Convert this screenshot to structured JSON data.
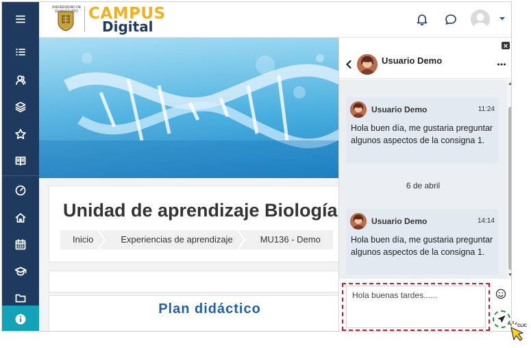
{
  "header": {
    "university_name": "UNIVERSIDAD DE GUANAJUATO",
    "logo_line1": "CAMPUS",
    "logo_line2": "Digital"
  },
  "sidebar": {
    "items": [
      {
        "icon": "menu-icon"
      },
      {
        "icon": "list-icon"
      },
      {
        "icon": "participants-icon"
      },
      {
        "icon": "layers-icon"
      },
      {
        "icon": "star-icon"
      },
      {
        "icon": "book-icon"
      },
      {
        "icon": "gauge-icon"
      },
      {
        "icon": "home-icon"
      },
      {
        "icon": "calendar-icon"
      },
      {
        "icon": "graduation-cap-icon"
      },
      {
        "icon": "folder-icon"
      },
      {
        "icon": "info-icon"
      }
    ]
  },
  "course": {
    "title": "Unidad de aprendizaje Biología",
    "breadcrumb": [
      "Inicio",
      "Experiencias de aprendizaje",
      "MU136 - Demo"
    ],
    "section_title": "Plan didáctico"
  },
  "chat": {
    "contact_name": "Usuario Demo",
    "messages": [
      {
        "sender": "Usuario Demo",
        "time": "11:24",
        "text": "Hola buen día, me gustaria preguntar algunos aspectos de la consigna 1."
      },
      {
        "sender": "Usuario Demo",
        "time": "14:14",
        "text": "Hola buen día, me gustaria preguntar algunos aspectos de la consigna 1."
      }
    ],
    "date_separator": "6 de abril",
    "compose_value": "Hola buenas tardes......",
    "cursor_label": "CLIC"
  },
  "colors": {
    "sidebar": "#1f3a5f",
    "accent": "#12a3b8",
    "logo_gold": "#f2b01e",
    "highlight_red": "#d4132b",
    "highlight_green": "#2d8a3c"
  }
}
